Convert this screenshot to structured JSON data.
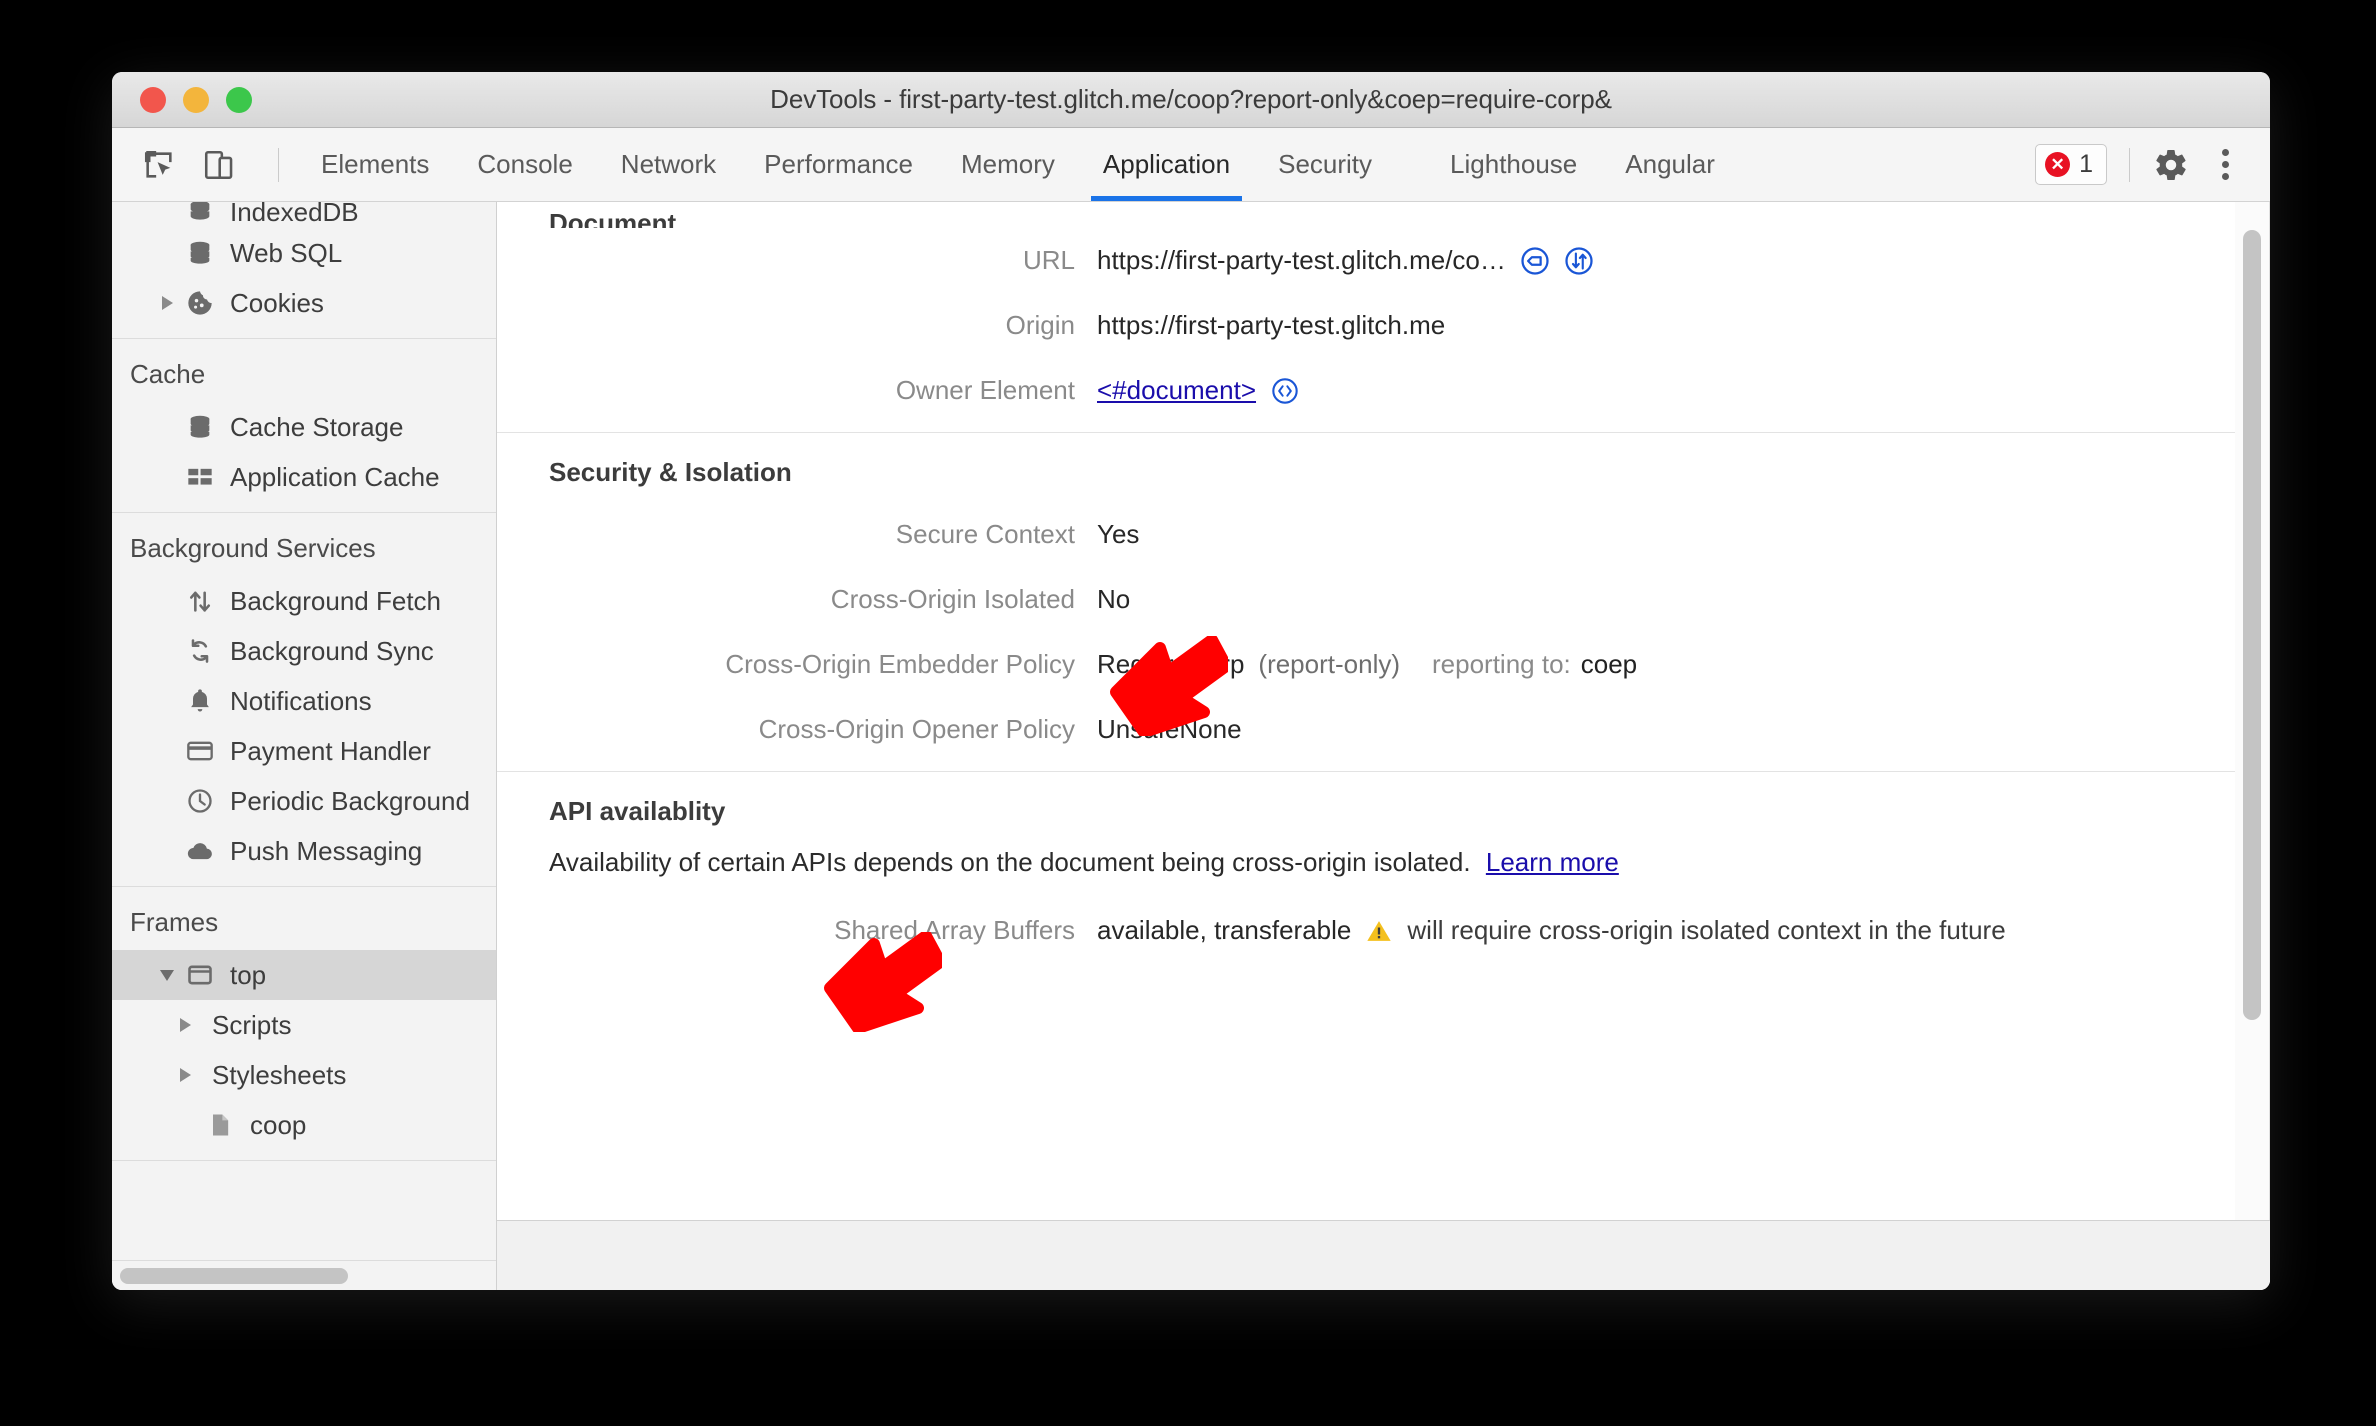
{
  "window": {
    "title": "DevTools - first-party-test.glitch.me/coop?report-only&coep=require-corp&",
    "traffic_lights": [
      "close",
      "minimize",
      "zoom"
    ]
  },
  "toolbar": {
    "inspect_icon": "inspect-element-icon",
    "device_icon": "device-toolbar-icon",
    "tabs": [
      {
        "label": "Elements",
        "active": false
      },
      {
        "label": "Console",
        "active": false
      },
      {
        "label": "Network",
        "active": false
      },
      {
        "label": "Performance",
        "active": false
      },
      {
        "label": "Memory",
        "active": false
      },
      {
        "label": "Application",
        "active": true
      },
      {
        "label": "Security",
        "active": false
      },
      {
        "label": "Lighthouse",
        "active": false
      },
      {
        "label": "Angular",
        "active": false
      }
    ],
    "error_count": "1",
    "settings_icon": "gear-icon",
    "more_icon": "kebab-menu-icon"
  },
  "sidebar": {
    "groups": [
      {
        "header": null,
        "items": [
          {
            "label": "IndexedDB",
            "icon": "database-icon",
            "indent": 1,
            "twisty": "none",
            "clipped": true
          },
          {
            "label": "Web SQL",
            "icon": "database-icon",
            "indent": 1,
            "twisty": "none"
          },
          {
            "label": "Cookies",
            "icon": "cookie-icon",
            "indent": 1,
            "twisty": "collapsed"
          }
        ]
      },
      {
        "header": "Cache",
        "items": [
          {
            "label": "Cache Storage",
            "icon": "database-icon",
            "indent": 1,
            "twisty": "none"
          },
          {
            "label": "Application Cache",
            "icon": "grid-icon",
            "indent": 1,
            "twisty": "none"
          }
        ]
      },
      {
        "header": "Background Services",
        "items": [
          {
            "label": "Background Fetch",
            "icon": "arrows-updown-icon",
            "indent": 1,
            "twisty": "none"
          },
          {
            "label": "Background Sync",
            "icon": "sync-icon",
            "indent": 1,
            "twisty": "none"
          },
          {
            "label": "Notifications",
            "icon": "bell-icon",
            "indent": 1,
            "twisty": "none"
          },
          {
            "label": "Payment Handler",
            "icon": "credit-card-icon",
            "indent": 1,
            "twisty": "none"
          },
          {
            "label": "Periodic Background",
            "icon": "clock-icon",
            "indent": 1,
            "twisty": "none"
          },
          {
            "label": "Push Messaging",
            "icon": "cloud-icon",
            "indent": 1,
            "twisty": "none"
          }
        ]
      },
      {
        "header": "Frames",
        "items": [
          {
            "label": "top",
            "icon": "frame-icon",
            "indent": 1,
            "twisty": "expanded",
            "selected": true
          },
          {
            "label": "Scripts",
            "icon": "none",
            "indent": 2,
            "twisty": "collapsed"
          },
          {
            "label": "Stylesheets",
            "icon": "none",
            "indent": 2,
            "twisty": "collapsed"
          },
          {
            "label": "coop",
            "icon": "file-icon",
            "indent": 3,
            "twisty": "none"
          }
        ]
      }
    ]
  },
  "main": {
    "document_section": {
      "title": "Document",
      "rows": [
        {
          "label": "URL",
          "value": "https://first-party-test.glitch.me/co…",
          "icons": [
            "open-in-elements-icon",
            "open-in-network-icon"
          ]
        },
        {
          "label": "Origin",
          "value": "https://first-party-test.glitch.me",
          "icons": []
        },
        {
          "label": "Owner Element",
          "value": "<#document>",
          "icons": [
            "reveal-in-elements-icon"
          ],
          "is_link": true
        }
      ]
    },
    "security_section": {
      "title": "Security & Isolation",
      "rows": [
        {
          "label": "Secure Context",
          "value": "Yes",
          "extra": "",
          "extra2": "",
          "extra3": ""
        },
        {
          "label": "Cross-Origin Isolated",
          "value": "No",
          "extra": "",
          "extra2": "",
          "extra3": ""
        },
        {
          "label": "Cross-Origin Embedder Policy",
          "value": "RequireCorp",
          "extra": "(report-only)",
          "extra2": "reporting to:",
          "extra3": "coep"
        },
        {
          "label": "Cross-Origin Opener Policy",
          "value": "UnsafeNone",
          "extra": "",
          "extra2": "",
          "extra3": ""
        }
      ]
    },
    "api_section": {
      "title": "API availablity",
      "description": "Availability of certain APIs depends on the document being cross-origin isolated.",
      "learn_more": "Learn more",
      "rows": [
        {
          "label": "Shared Array Buffers",
          "value": "available, transferable",
          "warning_icon": "warning-triangle-icon",
          "warning_text": "will require cross-origin isolated context in the future"
        }
      ]
    }
  },
  "annotations": {
    "arrows": [
      {
        "name": "arrow-pointing-to-cross-origin-isolated",
        "color": "#FF0000"
      },
      {
        "name": "arrow-pointing-to-api-availability",
        "color": "#FF0000"
      }
    ]
  },
  "colors": {
    "accent": "#1a73e8",
    "link": "#1a0dab",
    "error": "#e81123",
    "warning": "#f4c01e",
    "annotation": "#FF0000"
  }
}
